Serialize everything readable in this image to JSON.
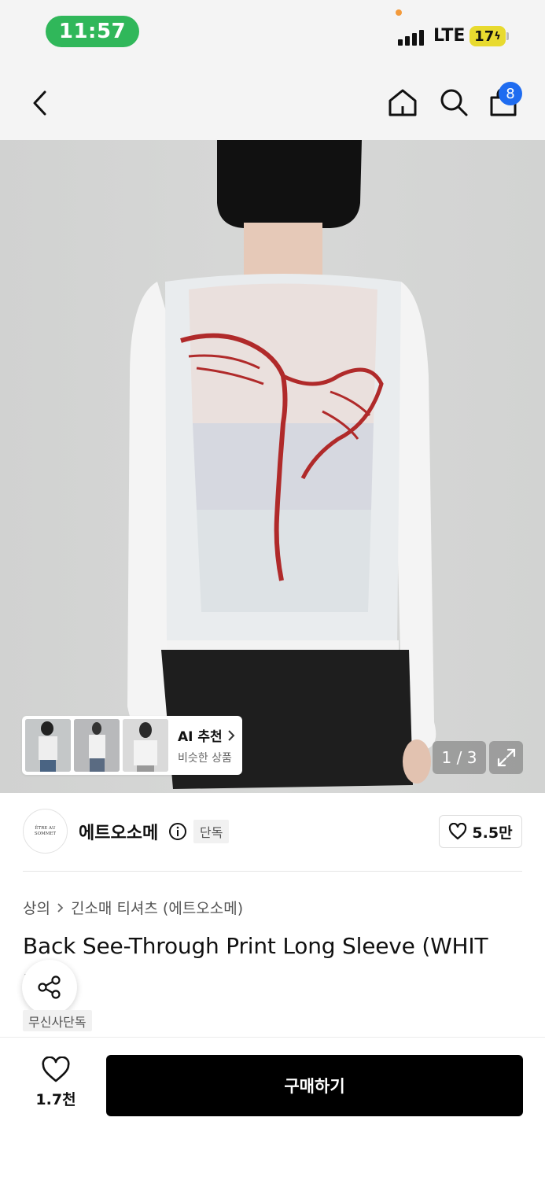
{
  "status_bar": {
    "time": "11:57",
    "network": "LTE",
    "battery": "17"
  },
  "nav": {
    "back_icon": "chevron-left-icon",
    "home_icon": "home-icon",
    "search_icon": "search-icon",
    "cart_icon": "shopping-bag-icon",
    "cart_count": "8"
  },
  "gallery": {
    "ai_recommend": {
      "title": "AI 추천",
      "subtitle": "비슷한 상품",
      "thumbnails": [
        "thumb-1",
        "thumb-2",
        "thumb-3"
      ]
    },
    "page_indicator": "1 / 3",
    "expand_icon": "expand-icon"
  },
  "brand": {
    "logo_text": "ÊTRE AU SOMMET",
    "name": "에트오소메",
    "exclusive_badge": "단독",
    "like_count": "5.5만"
  },
  "product": {
    "breadcrumb": [
      "상의",
      "긴소매 티셔츠 (에트오소메)"
    ],
    "title": "Back See-Through Print Long Sleeve (WHIT",
    "title_line2": "E)",
    "badge": "무신사단독"
  },
  "bottom_bar": {
    "wish_count": "1.7천",
    "buy_label": "구매하기"
  },
  "colors": {
    "status_green": "#30b75a",
    "badge_blue": "#1f6cf0",
    "print_red": "#b02a2a"
  }
}
